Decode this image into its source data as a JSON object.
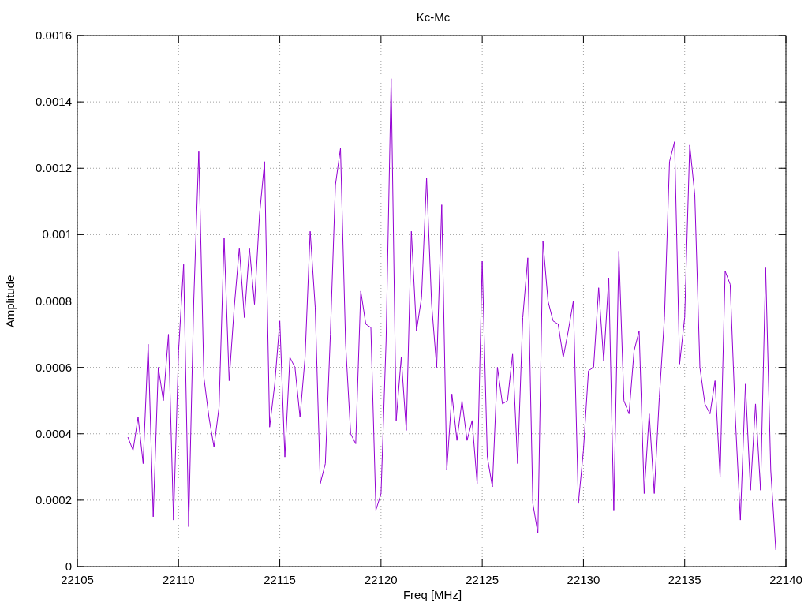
{
  "chart_data": {
    "type": "line",
    "grid": true,
    "title": "Kc-Mc",
    "xlabel": "Freq [MHz]",
    "ylabel": "Amplitude",
    "xlim": [
      22105,
      22140
    ],
    "ylim": [
      0,
      0.0016
    ],
    "xticks": [
      22105,
      22110,
      22115,
      22120,
      22125,
      22130,
      22135,
      22140
    ],
    "yticks": [
      0,
      0.0002,
      0.0004,
      0.0006,
      0.0008,
      0.001,
      0.0012,
      0.0014,
      0.0016
    ],
    "x": [
      22107.5,
      22107.75,
      22108,
      22108.25,
      22108.5,
      22108.75,
      22109,
      22109.25,
      22109.5,
      22109.75,
      22110,
      22110.25,
      22110.5,
      22110.75,
      22111,
      22111.25,
      22111.5,
      22111.75,
      22112,
      22112.25,
      22112.5,
      22112.75,
      22113,
      22113.25,
      22113.5,
      22113.75,
      22114,
      22114.25,
      22114.5,
      22114.75,
      22115,
      22115.25,
      22115.5,
      22115.75,
      22116,
      22116.25,
      22116.5,
      22116.75,
      22117,
      22117.25,
      22117.5,
      22117.75,
      22118,
      22118.25,
      22118.5,
      22118.75,
      22119,
      22119.25,
      22119.5,
      22119.75,
      22120,
      22120.25,
      22120.5,
      22120.75,
      22121,
      22121.25,
      22121.5,
      22121.75,
      22122,
      22122.25,
      22122.5,
      22122.75,
      22123,
      22123.25,
      22123.5,
      22123.75,
      22124,
      22124.25,
      22124.5,
      22124.75,
      22125,
      22125.25,
      22125.5,
      22125.75,
      22126,
      22126.25,
      22126.5,
      22126.75,
      22127,
      22127.25,
      22127.5,
      22127.75,
      22128,
      22128.25,
      22128.5,
      22128.75,
      22129,
      22129.25,
      22129.5,
      22129.75,
      22130,
      22130.25,
      22130.5,
      22130.75,
      22131,
      22131.25,
      22131.5,
      22131.75,
      22132,
      22132.25,
      22132.5,
      22132.75,
      22133,
      22133.25,
      22133.5,
      22133.75,
      22134,
      22134.25,
      22134.5,
      22134.75,
      22135,
      22135.25,
      22135.5,
      22135.75,
      22136,
      22136.25,
      22136.5,
      22136.75,
      22137,
      22137.25,
      22137.5,
      22137.75,
      22138,
      22138.25,
      22138.5,
      22138.75,
      22139,
      22139.25,
      22139.5
    ],
    "series": [
      {
        "color": "#9400d3",
        "values": [
          0.00039,
          0.00035,
          0.00045,
          0.00031,
          0.00067,
          0.00015,
          0.0006,
          0.0005,
          0.0007,
          0.00014,
          0.00065,
          0.00091,
          0.00012,
          0.0008,
          0.00125,
          0.00057,
          0.00045,
          0.00036,
          0.00048,
          0.00099,
          0.00056,
          0.00078,
          0.00096,
          0.00075,
          0.00096,
          0.00079,
          0.00106,
          0.00122,
          0.00042,
          0.00055,
          0.00074,
          0.00033,
          0.00063,
          0.0006,
          0.00045,
          0.00063,
          0.00101,
          0.00078,
          0.00025,
          0.00031,
          0.0007,
          0.00115,
          0.00126,
          0.00067,
          0.0004,
          0.00037,
          0.00083,
          0.00073,
          0.00072,
          0.00017,
          0.00022,
          0.00068,
          0.00147,
          0.00044,
          0.00063,
          0.00041,
          0.00101,
          0.00071,
          0.00081,
          0.00117,
          0.00079,
          0.0006,
          0.00109,
          0.00029,
          0.00052,
          0.00038,
          0.0005,
          0.00038,
          0.00044,
          0.00025,
          0.00092,
          0.00033,
          0.00024,
          0.0006,
          0.00049,
          0.0005,
          0.00064,
          0.00031,
          0.00075,
          0.00093,
          0.00019,
          0.0001,
          0.00098,
          0.0008,
          0.00074,
          0.00073,
          0.00063,
          0.00071,
          0.0008,
          0.00019,
          0.00035,
          0.00059,
          0.0006,
          0.00084,
          0.00062,
          0.00087,
          0.00017,
          0.00095,
          0.0005,
          0.00046,
          0.00065,
          0.00071,
          0.00022,
          0.00046,
          0.00022,
          0.00051,
          0.00075,
          0.00122,
          0.00128,
          0.00061,
          0.00075,
          0.00127,
          0.00112,
          0.0006,
          0.00049,
          0.00046,
          0.00056,
          0.00027,
          0.00089,
          0.00085,
          0.00045,
          0.00014,
          0.00055,
          0.00023,
          0.00049,
          0.00023,
          0.0009,
          0.00029,
          5e-05
        ]
      }
    ]
  }
}
